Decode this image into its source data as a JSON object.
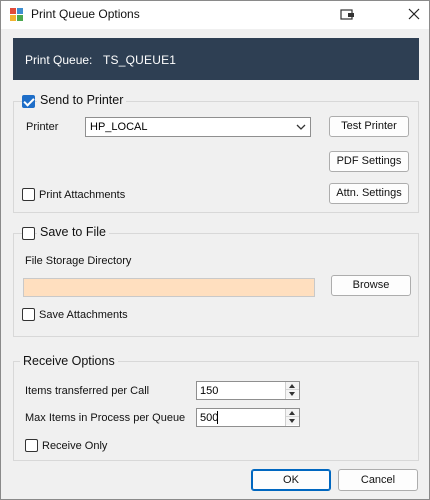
{
  "window": {
    "title": "Print Queue Options"
  },
  "banner": {
    "label": "Print Queue:",
    "value": "TS_QUEUE1"
  },
  "send_to_printer": {
    "title": "Send to Printer",
    "checked": true,
    "printer_label": "Printer",
    "printer_value": "HP_LOCAL",
    "test_printer_label": "Test Printer",
    "pdf_settings_label": "PDF Settings",
    "print_attachments_label": "Print Attachments",
    "print_attachments_checked": false,
    "attn_settings_label": "Attn. Settings"
  },
  "save_to_file": {
    "title": "Save to File",
    "checked": false,
    "directory_label": "File Storage Directory",
    "directory_value": "",
    "browse_label": "Browse",
    "save_attachments_label": "Save Attachments",
    "save_attachments_checked": false
  },
  "receive_options": {
    "title": "Receive Options",
    "items_per_call_label": "Items transferred per Call",
    "items_per_call_value": "150",
    "max_items_label": "Max Items in Process per Queue",
    "max_items_value": "500",
    "receive_only_label": "Receive Only",
    "receive_only_checked": false
  },
  "footer": {
    "ok_label": "OK",
    "cancel_label": "Cancel"
  },
  "colors": {
    "banner_bg": "#2e3f53",
    "directory_field_bg": "#ffdfbf",
    "checkbox_checked": "#1e6ec8",
    "default_button_border": "#0067c0"
  },
  "icons": {
    "app": "printer-app-icon",
    "title_right": "window-pin-icon",
    "close": "close-icon",
    "combo": "chevron-down-icon"
  }
}
